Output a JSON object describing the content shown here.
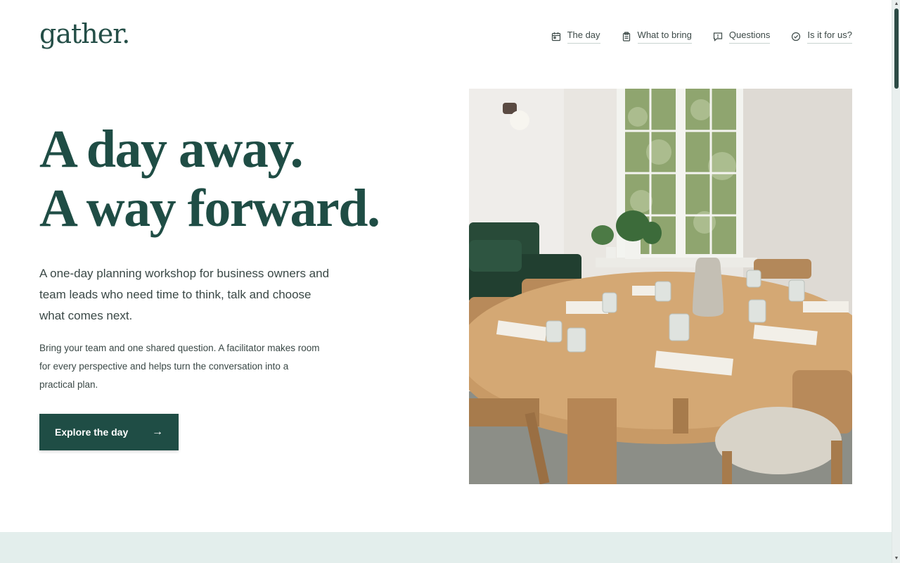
{
  "brand": {
    "logo_text": "gather.",
    "accent_color": "#1f4d45",
    "band_color": "#e3eeec"
  },
  "nav": {
    "items": [
      {
        "label": "The day",
        "icon": "calendar-icon"
      },
      {
        "label": "What to bring",
        "icon": "clipboard-icon"
      },
      {
        "label": "Questions",
        "icon": "chat-icon"
      },
      {
        "label": "Is it for us?",
        "icon": "check-circle-icon"
      }
    ]
  },
  "hero": {
    "headline_line1": "A day away.",
    "headline_line2": "A way forward.",
    "lead": "A one-day planning workshop for business owners and team leads who need time to think, talk and choose what comes next.",
    "body": "Bring your team and one shared question. A facilitator makes room for every perspective and helps turn the conversation into a practical plan.",
    "cta_label": "Explore the day",
    "cta_icon": "arrow-right-icon"
  },
  "image": {
    "subject": "meeting-room-photo"
  }
}
